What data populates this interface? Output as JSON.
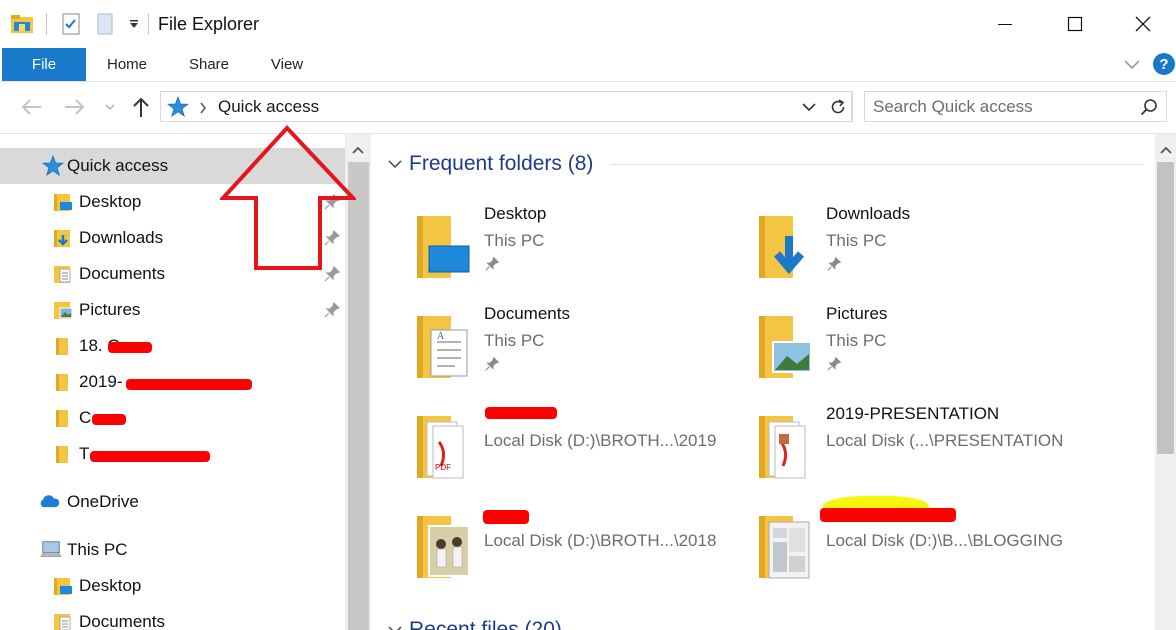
{
  "window": {
    "title": "File Explorer",
    "minimize_icon": "minimize-icon",
    "maximize_icon": "maximize-icon",
    "close_icon": "close-icon"
  },
  "ribbon": {
    "tabs": [
      {
        "label": "File"
      },
      {
        "label": "Home"
      },
      {
        "label": "Share"
      },
      {
        "label": "View"
      }
    ],
    "help_label": "?",
    "accent_color": "#1979ca"
  },
  "navbar": {
    "address": "Quick access",
    "search_placeholder": "Search Quick access"
  },
  "sidebar": {
    "quick_access": {
      "label": "Quick access"
    },
    "pinned": [
      {
        "label": "Desktop"
      },
      {
        "label": "Downloads"
      },
      {
        "label": "Documents"
      },
      {
        "label": "Pictures"
      }
    ],
    "recent": [
      {
        "label": "18. C"
      },
      {
        "label": "2019-"
      },
      {
        "label": "C"
      },
      {
        "label": "T"
      }
    ],
    "onedrive": {
      "label": "OneDrive"
    },
    "this_pc": {
      "label": "This PC"
    },
    "pc_items": [
      {
        "label": "Desktop"
      },
      {
        "label": "Documents"
      }
    ]
  },
  "main": {
    "frequent_header": "Frequent folders (8)",
    "recent_header": "Recent files (20)",
    "folders": [
      {
        "name": "Desktop",
        "path": "This PC",
        "icon": "desktop-folder-icon"
      },
      {
        "name": "Downloads",
        "path": "This PC",
        "icon": "downloads-folder-icon"
      },
      {
        "name": "Documents",
        "path": "This PC",
        "icon": "documents-folder-icon"
      },
      {
        "name": "Pictures",
        "path": "This PC",
        "icon": "pictures-folder-icon"
      },
      {
        "name": "",
        "path": "Local Disk (D:)\\BROTH...\\2019",
        "icon": "pdf-folder-icon"
      },
      {
        "name": "2019-PRESENTATION",
        "path": "Local Disk (...\\PRESENTATION",
        "icon": "pdf-folder-icon"
      },
      {
        "name": "",
        "path": "Local Disk (D:)\\BROTH...\\2018",
        "icon": "photo-folder-icon"
      },
      {
        "name": "",
        "path": "Local Disk (D:)\\B...\\BLOGGING",
        "icon": "screenshot-folder-icon"
      }
    ]
  },
  "annotation": {
    "color": "#e8141b"
  }
}
